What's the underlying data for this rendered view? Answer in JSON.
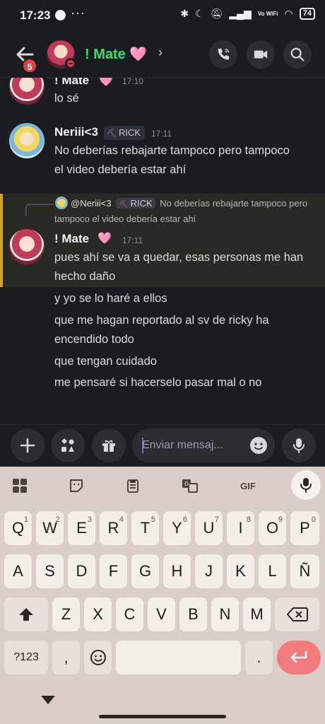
{
  "status_bar": {
    "time": "17:23",
    "more": "···",
    "network": "Vo WiFi",
    "battery": "74"
  },
  "header": {
    "unread_count": "5",
    "channel_name": "! Mate",
    "heart": "🩷",
    "chevron": "›",
    "icons": [
      "back-arrow-icon",
      "phone-icon",
      "video-camera-icon",
      "search-icon"
    ]
  },
  "messages": [
    {
      "author": "! Mate",
      "heart": "🩷",
      "time": "17:10",
      "lines": [
        "lo sé"
      ]
    },
    {
      "author": "Neriii<3",
      "tag": "RICK",
      "time": "17:11",
      "lines": [
        "No deberías rebajarte tampoco pero tampoco el video debería estar ahí"
      ]
    },
    {
      "reply": {
        "author": "@Neriii<3",
        "tag": "RICK",
        "text": "No deberías rebajarte tampoco pero tampoco el video debería estar ahí"
      },
      "author": "! Mate",
      "heart": "🩷",
      "time": "17:11",
      "lines": [
        "pues ahí se va a quedar, esas personas me han hecho daño"
      ]
    }
  ],
  "followups": [
    "y yo se lo haré a ellos",
    "que me hagan reportado al sv de ricky ha encendido todo",
    "que tengan cuidado",
    "me pensaré si hacerselo pasar mal o no"
  ],
  "composer": {
    "placeholder": "Enviar mensaj...",
    "icons": [
      "plus-icon",
      "apps-icon",
      "gift-icon",
      "emoji-icon",
      "microphone-icon"
    ]
  },
  "keyboard": {
    "toolbar": [
      "apps-grid-icon",
      "sticker-icon",
      "clipboard-icon",
      "translate-icon",
      "GIF",
      "microphone-icon"
    ],
    "row1": [
      [
        "Q",
        "1"
      ],
      [
        "W",
        "2"
      ],
      [
        "E",
        "3"
      ],
      [
        "R",
        "4"
      ],
      [
        "T",
        "5"
      ],
      [
        "Y",
        "6"
      ],
      [
        "U",
        "7"
      ],
      [
        "I",
        "8"
      ],
      [
        "O",
        "9"
      ],
      [
        "P",
        "0"
      ]
    ],
    "row2": [
      "A",
      "S",
      "D",
      "F",
      "G",
      "H",
      "J",
      "K",
      "L",
      "Ñ"
    ],
    "row3": [
      "Z",
      "X",
      "C",
      "V",
      "B",
      "N",
      "M"
    ],
    "row4": {
      "symbols": "?123",
      "comma": ",",
      "period": "."
    }
  }
}
